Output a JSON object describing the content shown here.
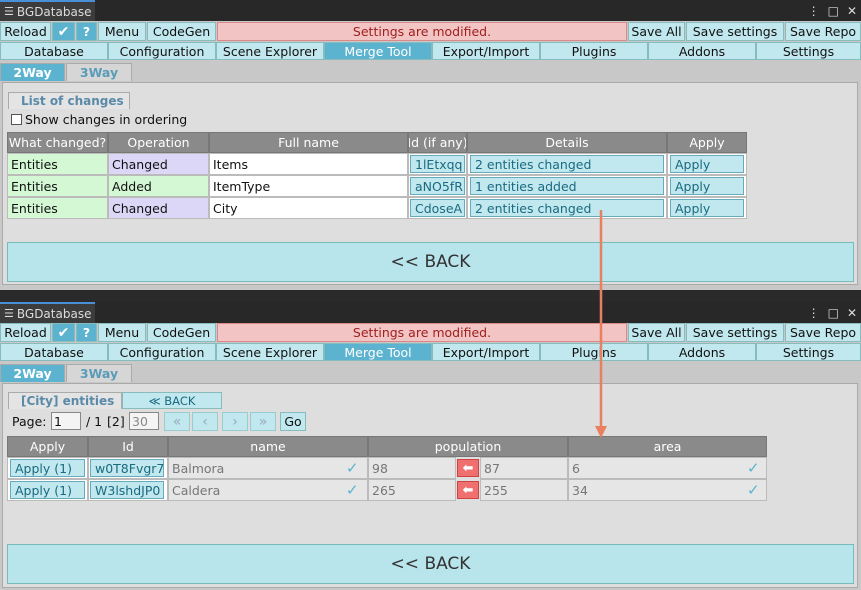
{
  "window": {
    "title": "BGDatabase"
  },
  "toolbar": {
    "reload": "Reload",
    "menu": "Menu",
    "codegen": "CodeGen",
    "status": "Settings are modified.",
    "save_all": "Save All",
    "save_settings": "Save settings",
    "save_repo": "Save Repo"
  },
  "tabs": [
    "Database",
    "Configuration",
    "Scene Explorer",
    "Merge Tool",
    "Export/Import",
    "Plugins",
    "Addons",
    "Settings"
  ],
  "subtabs": [
    "2Way",
    "3Way"
  ],
  "top": {
    "group_title": "List of changes",
    "checkbox_label": "Show changes in ordering",
    "headers": [
      "What changed?",
      "Operation",
      "Full name",
      "Id (if any)",
      "Details",
      "Apply"
    ],
    "rows": [
      {
        "what": "Entities",
        "op": "Changed",
        "name": "Items",
        "id": "1lEtxqq",
        "details": "2 entities changed",
        "apply": "Apply"
      },
      {
        "what": "Entities",
        "op": "Added",
        "name": "ItemType",
        "id": "aNO5fR",
        "details": "1 entities added",
        "apply": "Apply"
      },
      {
        "what": "Entities",
        "op": "Changed",
        "name": "City",
        "id": "CdoseA",
        "details": "2 entities changed",
        "apply": "Apply"
      }
    ],
    "back_label": "<< BACK"
  },
  "bottom": {
    "group_title": "[City] entities",
    "back_small": "≪ BACK",
    "page_label": "Page:",
    "page_value": "1",
    "page_total": "/ 1",
    "count": "[2]",
    "page_size": "30",
    "go_label": "Go",
    "headers": [
      "Apply",
      "Id",
      "name",
      "population",
      "area"
    ],
    "rows": [
      {
        "apply": "Apply (1)",
        "id": "w0T8Fvgr7",
        "name": "Balmora",
        "pop_left": "98",
        "pop_right": "87",
        "area": "6"
      },
      {
        "apply": "Apply (1)",
        "id": "W3lshdJP0",
        "name": "Caldera",
        "pop_left": "265",
        "pop_right": "255",
        "area": "34"
      }
    ],
    "back_label": "<< BACK"
  },
  "colors": {
    "accent": "#5cb3cf",
    "button": "#c1e8ee",
    "status_bg": "#f2c4c4",
    "status_text": "#a02020",
    "annotation_arrow": "#e8805e"
  }
}
